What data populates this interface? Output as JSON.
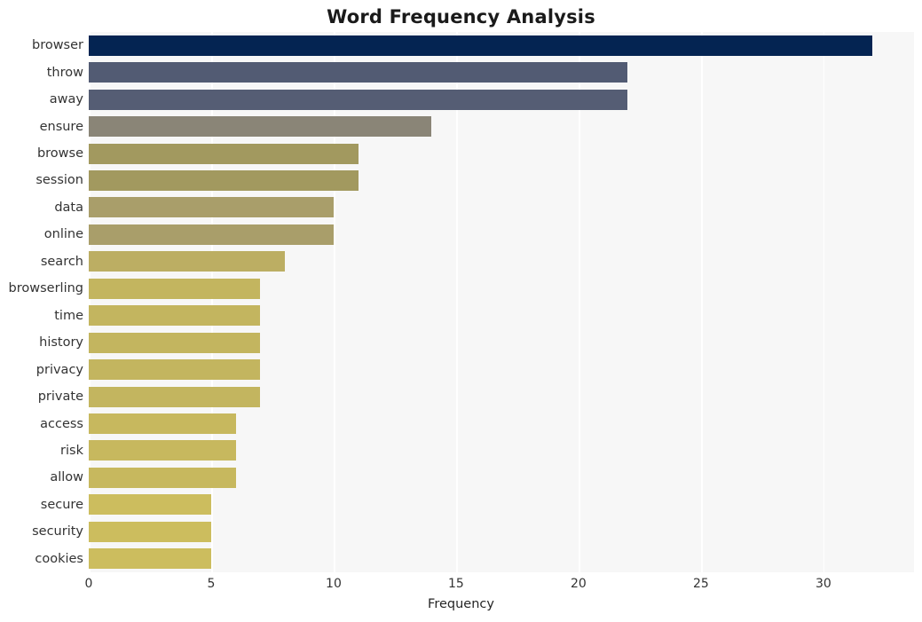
{
  "chart_data": {
    "type": "bar",
    "orientation": "horizontal",
    "title": "Word Frequency Analysis",
    "xlabel": "Frequency",
    "ylabel": "",
    "categories": [
      "browser",
      "throw",
      "away",
      "ensure",
      "browse",
      "session",
      "data",
      "online",
      "search",
      "browserling",
      "time",
      "history",
      "privacy",
      "private",
      "access",
      "risk",
      "allow",
      "secure",
      "security",
      "cookies"
    ],
    "values": [
      32,
      22,
      22,
      14,
      11,
      11,
      10,
      10,
      8,
      7,
      7,
      7,
      7,
      7,
      6,
      6,
      6,
      5,
      5,
      5
    ],
    "bar_colors": [
      "#042452",
      "#525b73",
      "#555d74",
      "#8a8577",
      "#a2995f",
      "#a2995f",
      "#a99e6a",
      "#a99e6a",
      "#bcae63",
      "#c3b55f",
      "#c3b55f",
      "#c3b55f",
      "#c3b55f",
      "#c3b55f",
      "#c7b85e",
      "#c7b85e",
      "#c7b85e",
      "#ccbd5e",
      "#ccbd5e",
      "#ccbd5e"
    ],
    "xlim": [
      0,
      33.7
    ],
    "xticks": [
      0,
      5,
      10,
      15,
      20,
      25,
      30
    ],
    "xtick_labels": [
      "0",
      "5",
      "10",
      "15",
      "20",
      "25",
      "30"
    ],
    "grid": true,
    "grid_axis": "x",
    "grid_color": "#ffffff",
    "plot_background": "#f7f7f7",
    "figure_background": "#ffffff",
    "legend": null,
    "legend_position": "none"
  }
}
